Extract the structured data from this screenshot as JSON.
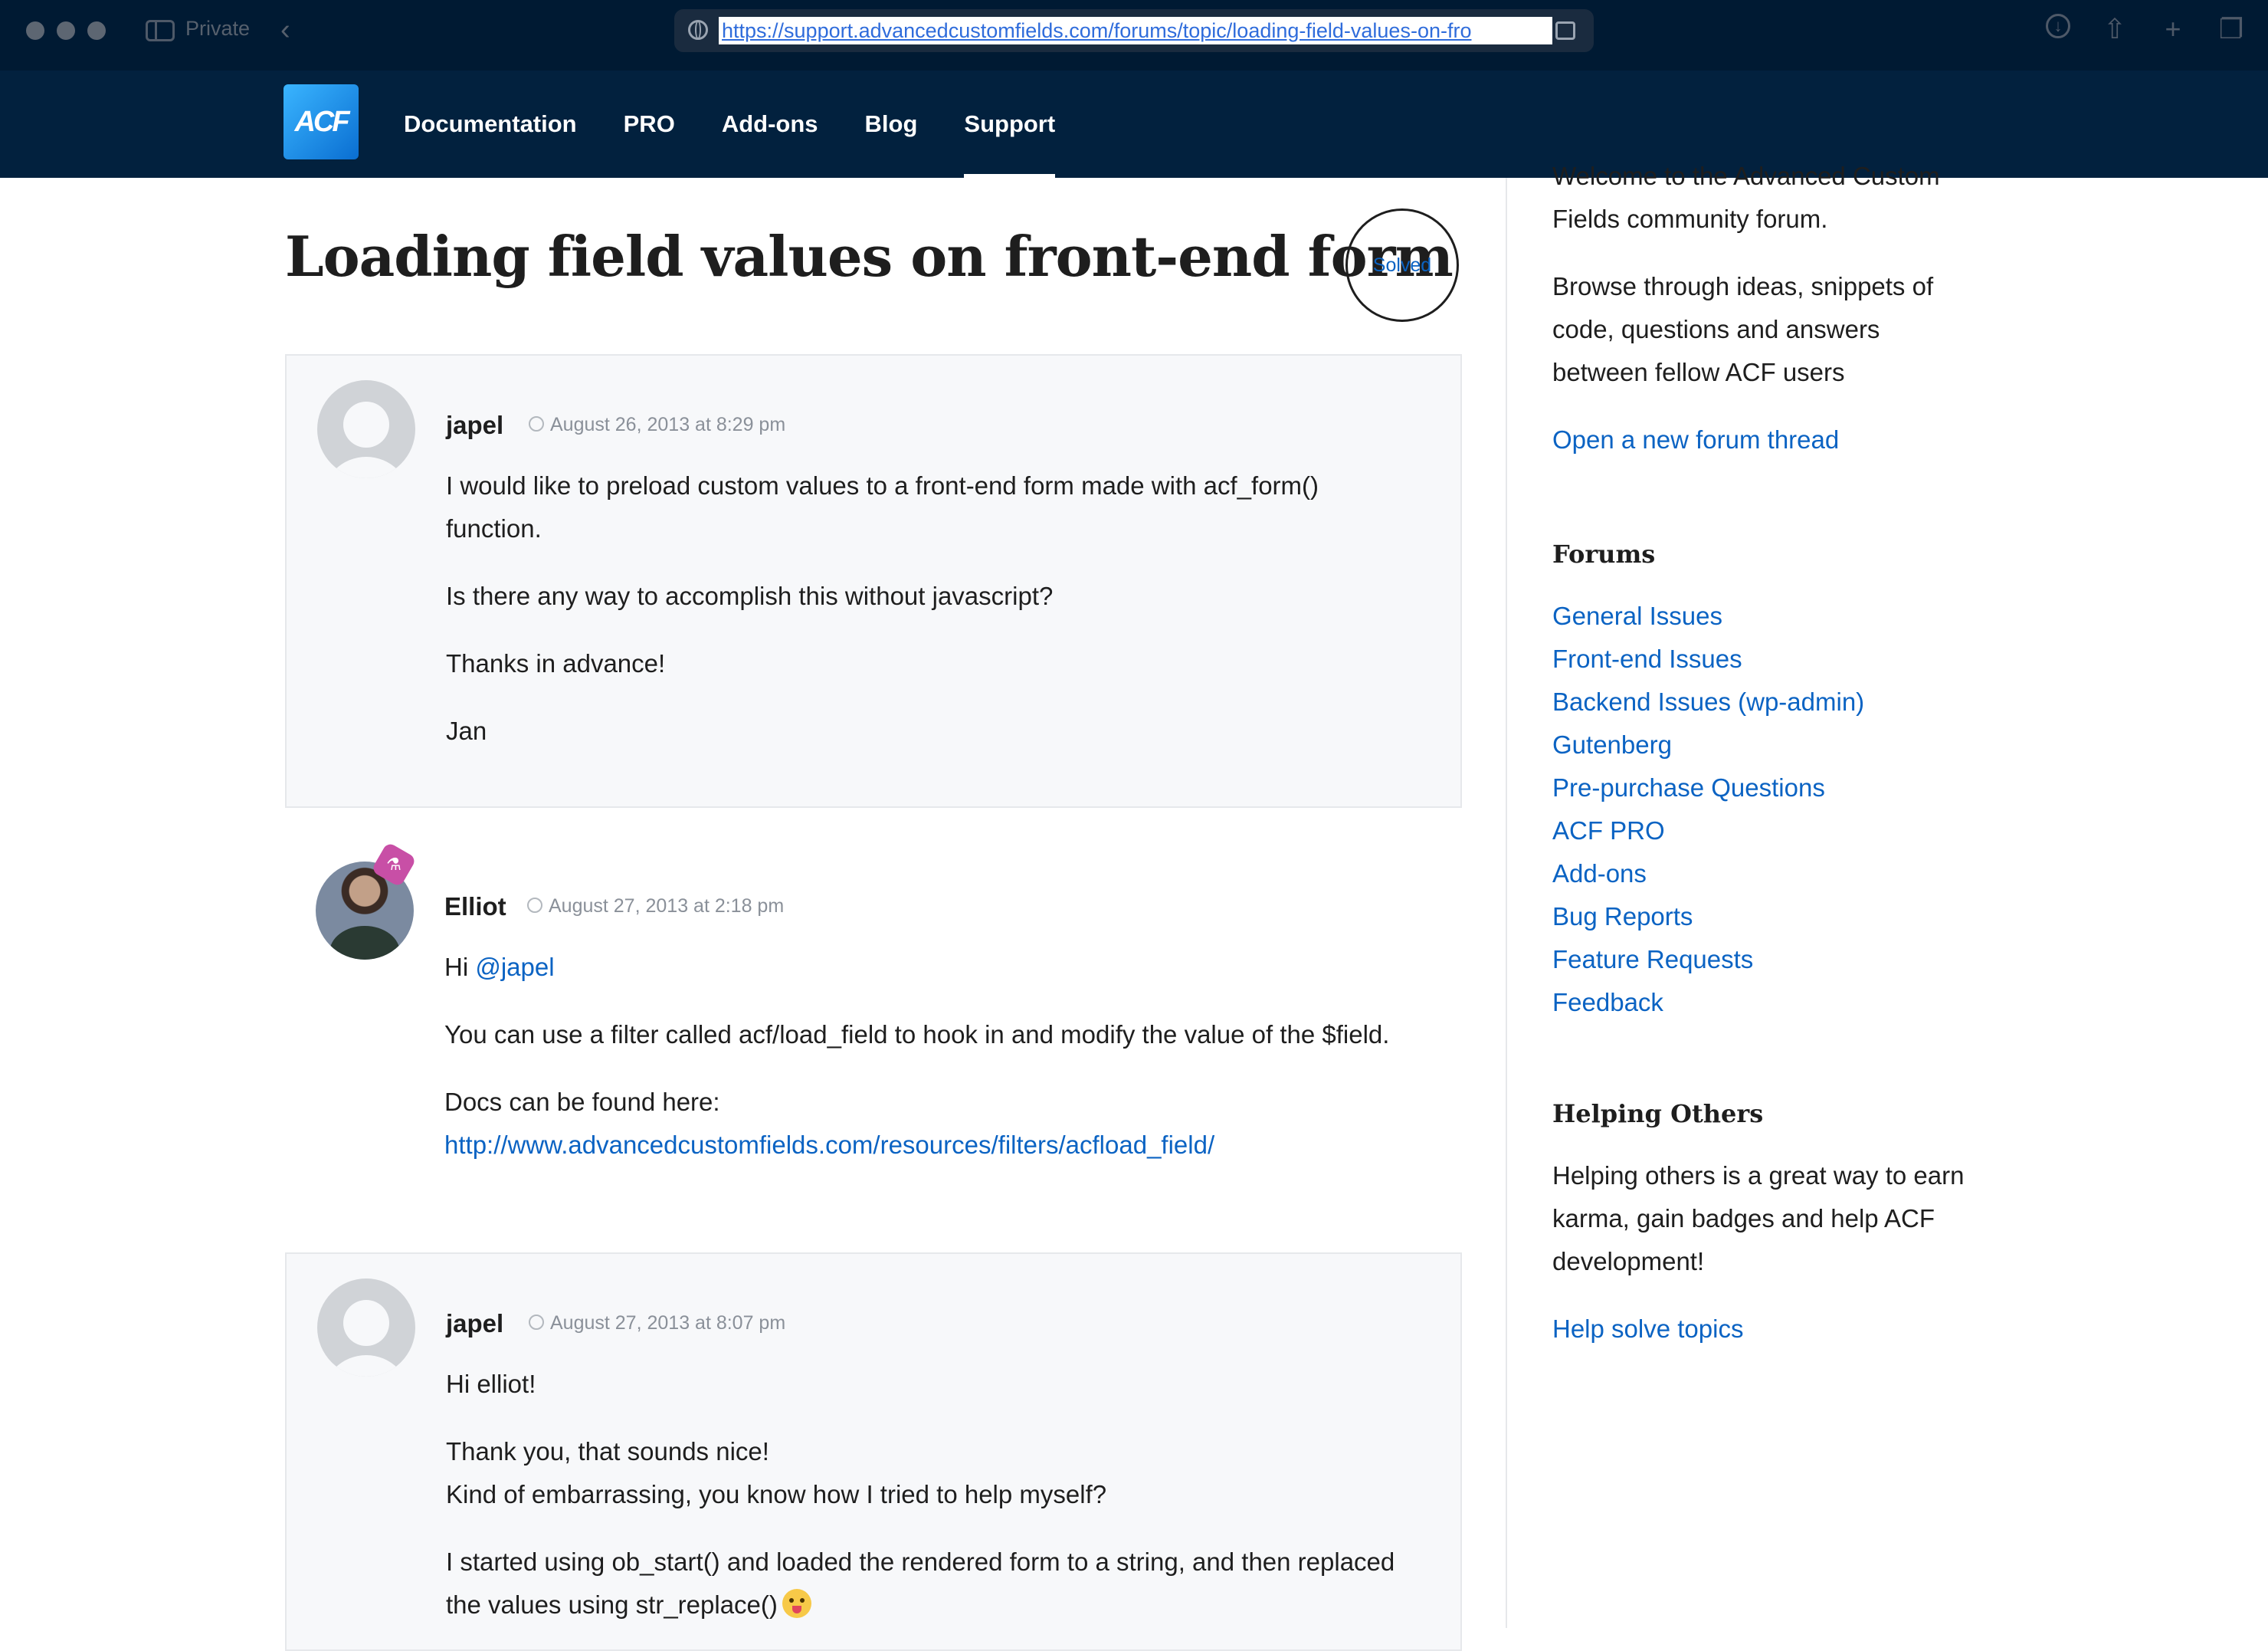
{
  "browser": {
    "private_label": "Private",
    "url": "https://support.advancedcustomfields.com/forums/topic/loading-field-values-on-fro"
  },
  "site": {
    "logo_text": "ACF",
    "nav": [
      "Documentation",
      "PRO",
      "Add-ons",
      "Blog",
      "Support"
    ],
    "active_nav": "Support"
  },
  "topic": {
    "title": "Loading field values on front-end form",
    "status": "Solved"
  },
  "posts": [
    {
      "author": "japel",
      "date": "August 26, 2013 at 8:29 pm",
      "paragraphs": [
        "I would like to preload custom values to a front-end form made with acf_form()",
        "function.",
        "Is there any way to accomplish this without javascript?",
        "Thanks in advance!",
        "Jan"
      ]
    },
    {
      "author": "Elliot",
      "date": "August 27, 2013 at 2:18 pm",
      "greeting": "Hi ",
      "mention": "@japel",
      "paragraphs": [
        "You can use a filter called acf/load_field to hook in and modify the value of the $field.",
        "Docs can be found here:"
      ],
      "doc_link": "http://www.advancedcustomfields.com/resources/filters/acfload_field/"
    },
    {
      "author": "japel",
      "date": "August 27, 2013 at 8:07 pm",
      "paragraphs": [
        "Hi elliot!",
        "Thank you, that sounds nice!",
        "Kind of embarrassing, you know how I tried to help myself?",
        "I started using ob_start() and loaded the rendered form to a string, and then replaced",
        "the values using str_replace()"
      ]
    }
  ],
  "sidebar": {
    "welcome_lines": [
      "Welcome to the Advanced Custom",
      "Fields community forum."
    ],
    "browse_lines": [
      "Browse through ideas, snippets of",
      "code, questions and answers",
      "between fellow ACF users"
    ],
    "new_thread_link": "Open a new forum thread",
    "forums_heading": "Forums",
    "forums": [
      "General Issues",
      "Front-end Issues",
      "Backend Issues (wp-admin)",
      "Gutenberg",
      "Pre-purchase Questions",
      "ACF PRO",
      "Add-ons",
      "Bug Reports",
      "Feature Requests",
      "Feedback"
    ],
    "helping_heading": "Helping Others",
    "helping_lines": [
      "Helping others is a great way to earn",
      "karma, gain badges and help ACF",
      "development!"
    ],
    "help_link": "Help solve topics"
  },
  "colors": {
    "chrome_bg": "#001a33",
    "header_bg": "#02213e",
    "link": "#0b63c3",
    "post_bg": "#f7f8fa"
  }
}
